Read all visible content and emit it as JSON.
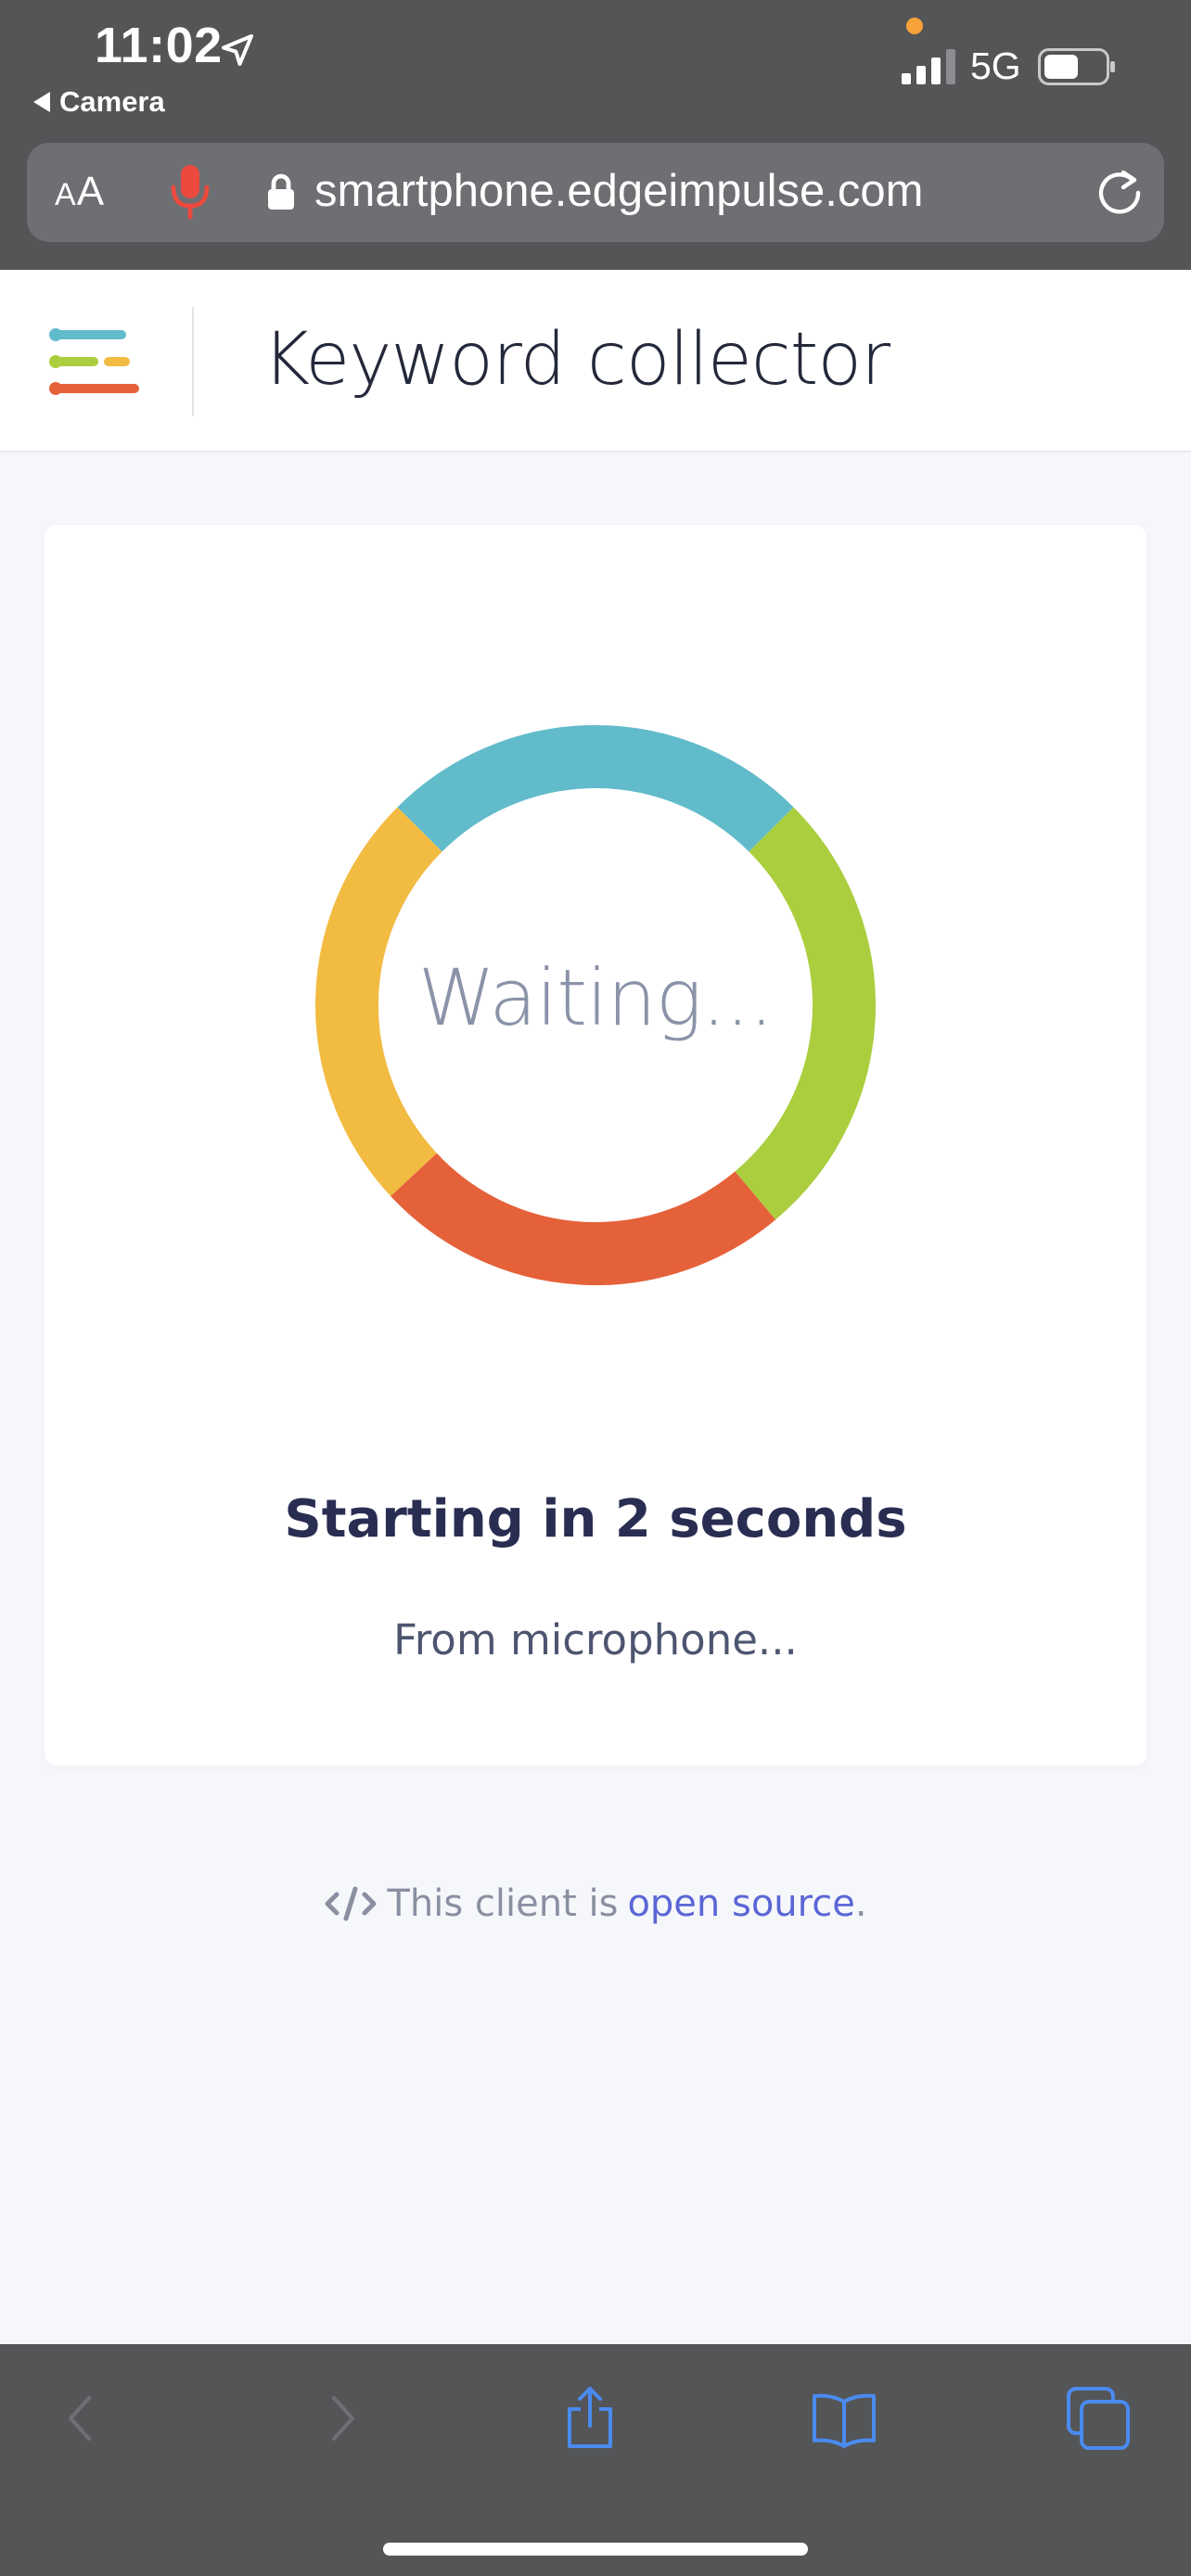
{
  "status_bar": {
    "time": "11:02",
    "back_app": "Camera",
    "network": "5G"
  },
  "browser": {
    "text_size_label_small": "A",
    "text_size_label_large": "A",
    "url": "smartphone.edgeimpulse.com"
  },
  "header": {
    "title": "Keyword collector"
  },
  "card": {
    "ring_label": "Waiting...",
    "status_heading": "Starting in 2 seconds",
    "status_sub": "From microphone...",
    "ring_colors": {
      "top": "#62bbcb",
      "right": "#abce3e",
      "bottom": "#e5613a",
      "left": "#f2bb41"
    }
  },
  "footer": {
    "prefix": "This client is",
    "link": "open source",
    "suffix": "."
  },
  "colors": {
    "browser_chrome": "#545557",
    "link": "#5b67d6",
    "toolbar_icon_active": "#4a8bf0",
    "toolbar_icon_disabled": "#6f7073"
  }
}
